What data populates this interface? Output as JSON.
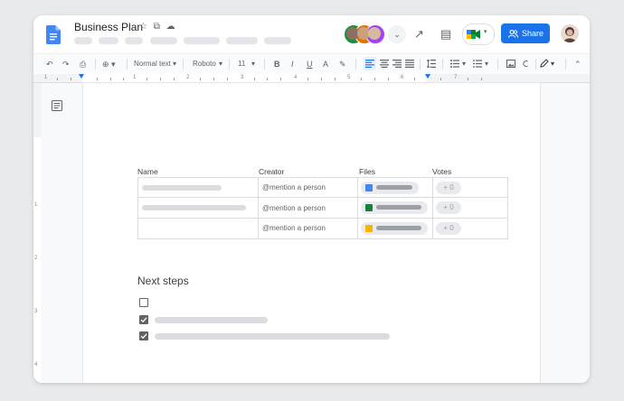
{
  "document": {
    "title": "Business Plan",
    "title_icons": "☆ ⧉ ☁"
  },
  "header": {
    "share_label": "Share",
    "collaborators_more": "⌄",
    "trend_icon": "↗",
    "comment_icon": "▤"
  },
  "toolbar": {
    "undo": "↶",
    "redo": "↷",
    "print": "⎙",
    "zoom": "⊕ ▾",
    "style_label": "Normal text",
    "font_label": "Roboto",
    "size_label": "11",
    "bold": "B",
    "italic": "I",
    "underline": "U",
    "text_color": "A",
    "highlight": "✎",
    "dropdown_caret": "▾",
    "collapse": "⌃"
  },
  "ruler": {
    "numbers": [
      "1",
      "1",
      "2",
      "3",
      "4",
      "5",
      "6",
      "7"
    ]
  },
  "vertical_ruler": {
    "numbers": [
      "1",
      "2",
      "3",
      "4"
    ]
  },
  "table": {
    "headers": {
      "name": "Name",
      "creator": "Creator",
      "files": "Files",
      "votes": "Votes"
    },
    "rows": [
      {
        "creator": "@mention a person",
        "file_color": "#4285f4",
        "votes": "+ 0"
      },
      {
        "creator": "@mention a person",
        "file_color": "#188038",
        "votes": "+ 0"
      },
      {
        "creator": "@mention a person",
        "file_color": "#f6b400",
        "votes": "+ 0"
      }
    ]
  },
  "next_steps": {
    "title": "Next steps",
    "tasks": [
      {
        "checked": false
      },
      {
        "checked": true
      },
      {
        "checked": true
      }
    ]
  },
  "colors": {
    "accent": "#1a73e8",
    "sheets_green": "#188038",
    "slides_yellow": "#f6b400",
    "docs_blue": "#4285f4"
  }
}
